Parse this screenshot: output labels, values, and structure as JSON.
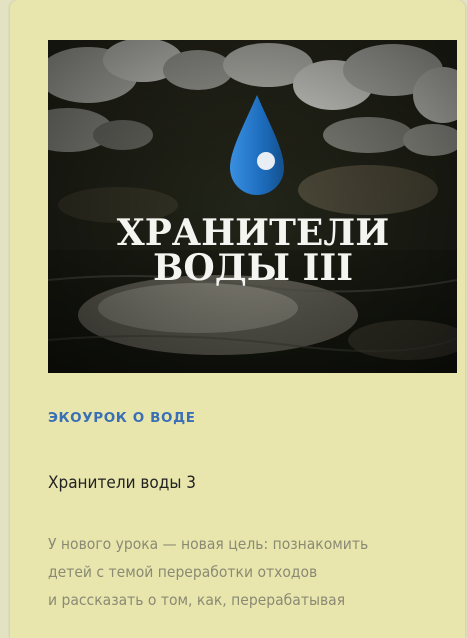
{
  "card": {
    "image": {
      "title_line1": "ХРАНИТЕЛИ",
      "title_line2": "ВОДЫ III",
      "icon": "water-drop-icon"
    },
    "category": "ЭКОУРОК О ВОДЕ",
    "title": "Хранители воды 3",
    "description_lines": [
      "У нового урока — новая цель: познакомить",
      "детей с темой переработки отходов",
      "и рассказать о том, как, перерабатывая"
    ]
  },
  "colors": {
    "card_background": "#e8e6ad",
    "page_background": "#e3e3c3",
    "category_color": "#3a6fb5",
    "drop_blue": "#1f6fc1"
  }
}
